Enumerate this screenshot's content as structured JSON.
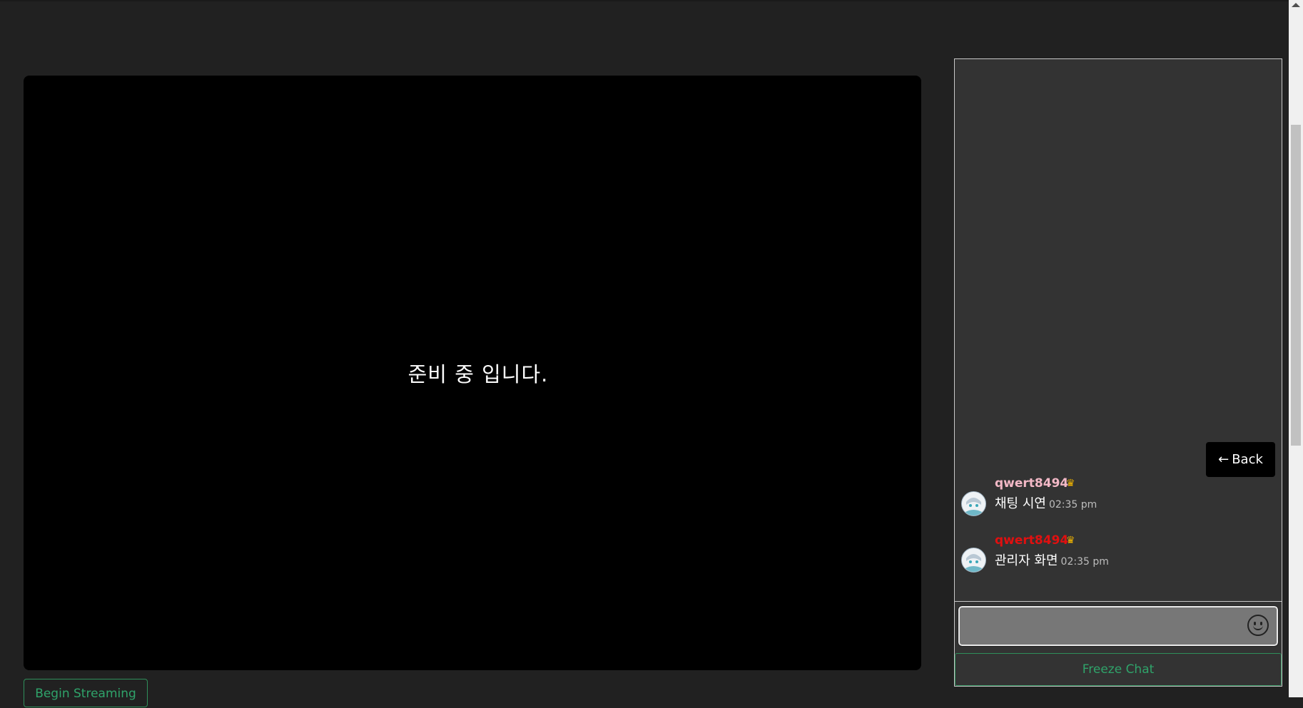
{
  "video": {
    "status_text": "준비 중 입니다."
  },
  "controls": {
    "begin_streaming_label": "Begin Streaming"
  },
  "chat": {
    "back_label": "Back",
    "back_icon": "left-arrow-icon",
    "messages": [
      {
        "username": "qwert8494",
        "username_color": "#f2b8c6",
        "badge_icon": "crown-icon",
        "text": "채팅 시연",
        "time": "02:35 pm"
      },
      {
        "username": "qwert8494",
        "username_color": "#e01010",
        "badge_icon": "crown-icon",
        "text": "관리자 화면",
        "time": "02:35 pm"
      }
    ],
    "input_value": "",
    "emoji_icon": "smiley-face-icon",
    "freeze_label": "Freeze Chat"
  },
  "colors": {
    "page_bg": "#212121",
    "chat_bg": "#333333",
    "accent_green": "#2fa36a",
    "crown": "#f0b400"
  }
}
